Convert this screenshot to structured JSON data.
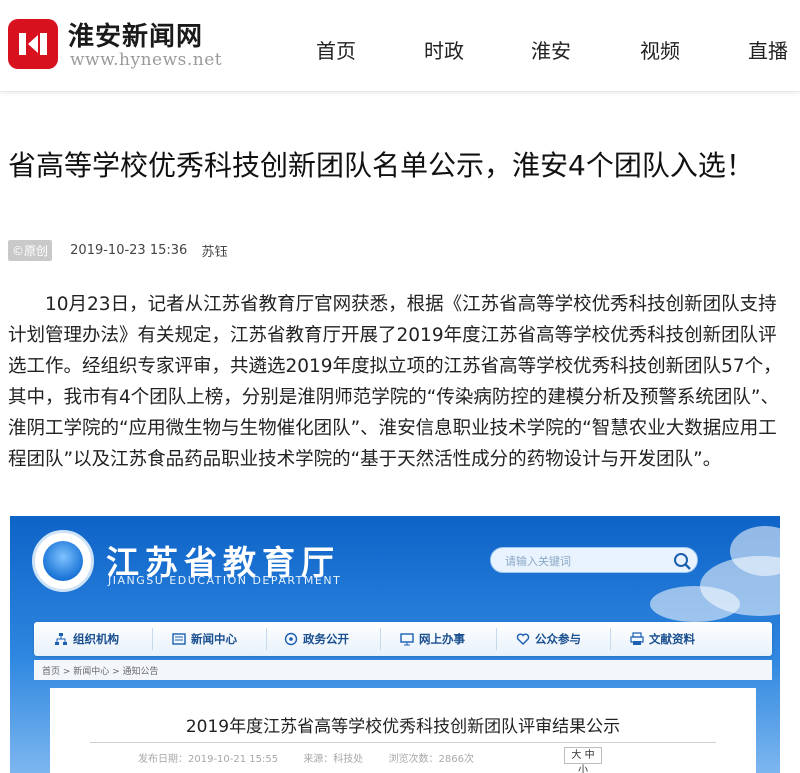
{
  "header": {
    "site_name": "淮安新闻网",
    "site_url": "www.hynews.net",
    "nav": [
      "首页",
      "时政",
      "淮安",
      "视频",
      "直播"
    ]
  },
  "article": {
    "title": "省高等学校优秀科技创新团队名单公示，淮安4个团队入选！",
    "badge": "©原创",
    "date": "2019-10-23 15:36",
    "author": "苏钰",
    "body": "10月23日，记者从江苏省教育厅官网获悉，根据《江苏省高等学校优秀科技创新团队支持计划管理办法》有关规定，江苏省教育厅开展了2019年度江苏省高等学校优秀科技创新团队评选工作。经组织专家评审，共遴选2019年度拟立项的江苏省高等学校优秀科技创新团队57个，其中，我市有4个团队上榜，分别是淮阴师范学院的“传染病防控的建模分析及预警系统团队”、淮阴工学院的“应用微生物与生物催化团队”、淮安信息职业技术学院的“智慧农业大数据应用工程团队”以及江苏食品药品职业技术学院的“基于天然活性成分的药物设计与开发团队”。"
  },
  "embedded": {
    "title": "江苏省教育厅",
    "subtitle": "JIANGSU EDUCATION DEPARTMENT",
    "search_placeholder": "请输入关键词",
    "nav": [
      {
        "label": "组织机构",
        "icon": "org-chart-icon"
      },
      {
        "label": "新闻中心",
        "icon": "news-icon"
      },
      {
        "label": "政务公开",
        "icon": "open-affairs-icon"
      },
      {
        "label": "网上办事",
        "icon": "monitor-icon"
      },
      {
        "label": "公众参与",
        "icon": "heart-icon"
      },
      {
        "label": "文献资料",
        "icon": "printer-icon"
      }
    ],
    "breadcrumb": "首页 > 新闻中心 > 通知公告",
    "notice_title": "2019年度江苏省高等学校优秀科技创新团队评审结果公示",
    "info": {
      "date": "发布日期：2019-10-21 15:55",
      "source": "来源：科技处",
      "views": "浏览次数：2866次"
    },
    "font_size": "大 中 小"
  },
  "colors": {
    "brand_red": "#d8111e",
    "edu_blue": "#0e63c7"
  }
}
